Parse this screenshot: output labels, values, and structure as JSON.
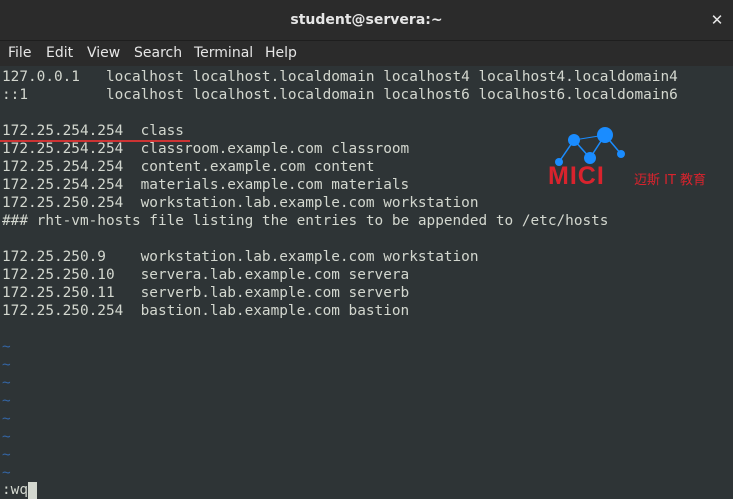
{
  "window": {
    "title": "student@servera:~",
    "close_glyph": "✕"
  },
  "menu": [
    "File",
    "Edit",
    "View",
    "Search",
    "Terminal",
    "Help"
  ],
  "terminal": {
    "lines": [
      "127.0.0.1   localhost localhost.localdomain localhost4 localhost4.localdomain4",
      "::1         localhost localhost.localdomain localhost6 localhost6.localdomain6",
      "",
      "172.25.254.254  class",
      "172.25.254.254  classroom.example.com classroom",
      "172.25.254.254  content.example.com content",
      "172.25.254.254  materials.example.com materials",
      "172.25.250.254  workstation.lab.example.com workstation",
      "### rht-vm-hosts file listing the entries to be appended to /etc/hosts",
      "",
      "172.25.250.9    workstation.lab.example.com workstation",
      "172.25.250.10   servera.lab.example.com servera",
      "172.25.250.11   serverb.lab.example.com serverb",
      "172.25.250.254  bastion.lab.example.com bastion",
      "",
      "~",
      "~",
      "~",
      "~",
      "~",
      "~",
      "~",
      "~"
    ],
    "command": ":wq"
  },
  "watermark": {
    "brand": "MICI",
    "subtitle": "迈斯 IT 教育",
    "color": "#d9232d",
    "accent": "#1a8cff"
  }
}
